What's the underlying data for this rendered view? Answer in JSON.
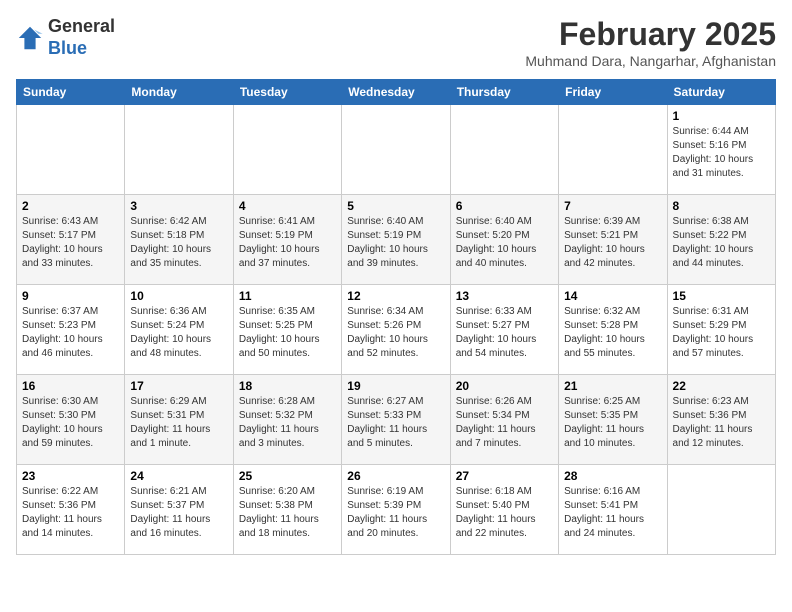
{
  "header": {
    "logo_line1": "General",
    "logo_line2": "Blue",
    "title": "February 2025",
    "subtitle": "Muhmand Dara, Nangarhar, Afghanistan"
  },
  "weekdays": [
    "Sunday",
    "Monday",
    "Tuesday",
    "Wednesday",
    "Thursday",
    "Friday",
    "Saturday"
  ],
  "weeks": [
    [
      {
        "day": "",
        "info": ""
      },
      {
        "day": "",
        "info": ""
      },
      {
        "day": "",
        "info": ""
      },
      {
        "day": "",
        "info": ""
      },
      {
        "day": "",
        "info": ""
      },
      {
        "day": "",
        "info": ""
      },
      {
        "day": "1",
        "info": "Sunrise: 6:44 AM\nSunset: 5:16 PM\nDaylight: 10 hours and 31 minutes."
      }
    ],
    [
      {
        "day": "2",
        "info": "Sunrise: 6:43 AM\nSunset: 5:17 PM\nDaylight: 10 hours and 33 minutes."
      },
      {
        "day": "3",
        "info": "Sunrise: 6:42 AM\nSunset: 5:18 PM\nDaylight: 10 hours and 35 minutes."
      },
      {
        "day": "4",
        "info": "Sunrise: 6:41 AM\nSunset: 5:19 PM\nDaylight: 10 hours and 37 minutes."
      },
      {
        "day": "5",
        "info": "Sunrise: 6:40 AM\nSunset: 5:19 PM\nDaylight: 10 hours and 39 minutes."
      },
      {
        "day": "6",
        "info": "Sunrise: 6:40 AM\nSunset: 5:20 PM\nDaylight: 10 hours and 40 minutes."
      },
      {
        "day": "7",
        "info": "Sunrise: 6:39 AM\nSunset: 5:21 PM\nDaylight: 10 hours and 42 minutes."
      },
      {
        "day": "8",
        "info": "Sunrise: 6:38 AM\nSunset: 5:22 PM\nDaylight: 10 hours and 44 minutes."
      }
    ],
    [
      {
        "day": "9",
        "info": "Sunrise: 6:37 AM\nSunset: 5:23 PM\nDaylight: 10 hours and 46 minutes."
      },
      {
        "day": "10",
        "info": "Sunrise: 6:36 AM\nSunset: 5:24 PM\nDaylight: 10 hours and 48 minutes."
      },
      {
        "day": "11",
        "info": "Sunrise: 6:35 AM\nSunset: 5:25 PM\nDaylight: 10 hours and 50 minutes."
      },
      {
        "day": "12",
        "info": "Sunrise: 6:34 AM\nSunset: 5:26 PM\nDaylight: 10 hours and 52 minutes."
      },
      {
        "day": "13",
        "info": "Sunrise: 6:33 AM\nSunset: 5:27 PM\nDaylight: 10 hours and 54 minutes."
      },
      {
        "day": "14",
        "info": "Sunrise: 6:32 AM\nSunset: 5:28 PM\nDaylight: 10 hours and 55 minutes."
      },
      {
        "day": "15",
        "info": "Sunrise: 6:31 AM\nSunset: 5:29 PM\nDaylight: 10 hours and 57 minutes."
      }
    ],
    [
      {
        "day": "16",
        "info": "Sunrise: 6:30 AM\nSunset: 5:30 PM\nDaylight: 10 hours and 59 minutes."
      },
      {
        "day": "17",
        "info": "Sunrise: 6:29 AM\nSunset: 5:31 PM\nDaylight: 11 hours and 1 minute."
      },
      {
        "day": "18",
        "info": "Sunrise: 6:28 AM\nSunset: 5:32 PM\nDaylight: 11 hours and 3 minutes."
      },
      {
        "day": "19",
        "info": "Sunrise: 6:27 AM\nSunset: 5:33 PM\nDaylight: 11 hours and 5 minutes."
      },
      {
        "day": "20",
        "info": "Sunrise: 6:26 AM\nSunset: 5:34 PM\nDaylight: 11 hours and 7 minutes."
      },
      {
        "day": "21",
        "info": "Sunrise: 6:25 AM\nSunset: 5:35 PM\nDaylight: 11 hours and 10 minutes."
      },
      {
        "day": "22",
        "info": "Sunrise: 6:23 AM\nSunset: 5:36 PM\nDaylight: 11 hours and 12 minutes."
      }
    ],
    [
      {
        "day": "23",
        "info": "Sunrise: 6:22 AM\nSunset: 5:36 PM\nDaylight: 11 hours and 14 minutes."
      },
      {
        "day": "24",
        "info": "Sunrise: 6:21 AM\nSunset: 5:37 PM\nDaylight: 11 hours and 16 minutes."
      },
      {
        "day": "25",
        "info": "Sunrise: 6:20 AM\nSunset: 5:38 PM\nDaylight: 11 hours and 18 minutes."
      },
      {
        "day": "26",
        "info": "Sunrise: 6:19 AM\nSunset: 5:39 PM\nDaylight: 11 hours and 20 minutes."
      },
      {
        "day": "27",
        "info": "Sunrise: 6:18 AM\nSunset: 5:40 PM\nDaylight: 11 hours and 22 minutes."
      },
      {
        "day": "28",
        "info": "Sunrise: 6:16 AM\nSunset: 5:41 PM\nDaylight: 11 hours and 24 minutes."
      },
      {
        "day": "",
        "info": ""
      }
    ]
  ]
}
